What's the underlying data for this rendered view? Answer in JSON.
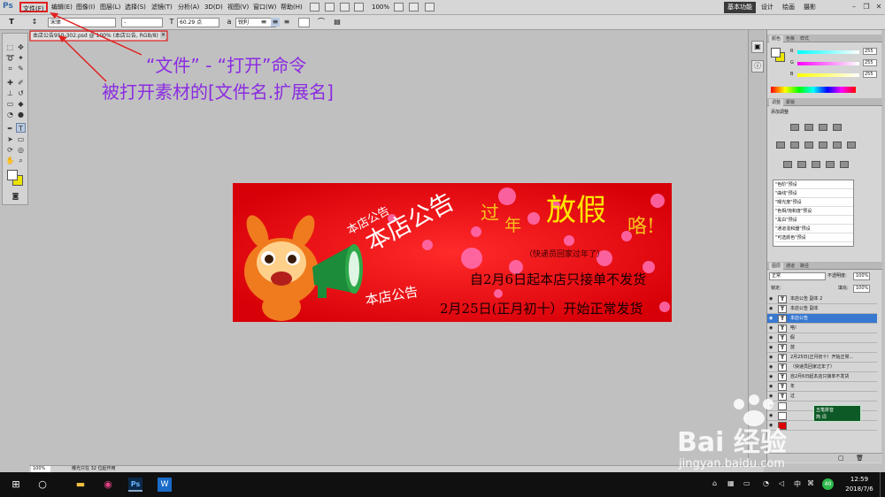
{
  "menubar": {
    "app_logo": "Ps",
    "items": [
      "文件(F)",
      "编辑(E)",
      "图像(I)",
      "图层(L)",
      "选择(S)",
      "滤镜(T)",
      "分析(A)",
      "3D(D)",
      "视图(V)",
      "窗口(W)",
      "帮助(H)"
    ],
    "zoom": "100%",
    "workspaces": [
      "基本功能",
      "设计",
      "绘画",
      "摄影"
    ],
    "window_controls": [
      "minimize-icon",
      "restore-icon",
      "close-icon"
    ]
  },
  "options": {
    "tool_glyph": "T",
    "font_family": "宋体",
    "font_style": "-",
    "font_size": "60.29 点",
    "aa_mode": "锐利",
    "align_icons": [
      "align-left-icon",
      "align-center-icon",
      "align-right-icon"
    ]
  },
  "document": {
    "tab_title": "本店公告950-302.psd @ 100% (本店公告, RGB/8)",
    "image": {
      "notice_title_big": "本店公告",
      "notice_title_small_top": "本店公告",
      "notice_title_small_bottom": "本店公告",
      "headline_guo": "过",
      "headline_nian": "年",
      "headline_fangjia": "放假",
      "headline_lo": "咯!",
      "courier_note": "（快递员回家过年了）",
      "line1": "自2月6日起本店只接单不发货",
      "line2": "2月25日(正月初十）开始正常发货"
    }
  },
  "annotations": {
    "line1": "“文件” - “打开”命令",
    "line2": "被打开素材的[文件名.扩展名]"
  },
  "status": {
    "zoom": "100%",
    "text": "曝光只在 32 位起作用"
  },
  "color_panel": {
    "tabs": [
      "颜色",
      "色板",
      "样式"
    ],
    "rows": [
      {
        "label": "R",
        "value": "255",
        "color": "#e03030"
      },
      {
        "label": "G",
        "value": "255",
        "color": "#30b030"
      },
      {
        "label": "B",
        "value": "255",
        "color": "#3050e0"
      }
    ]
  },
  "adjust_panel": {
    "tabs": [
      "调整",
      "蒙版"
    ],
    "title": "添加调整",
    "presets": [
      "\"色阶\"预设",
      "\"曲线\"预设",
      "\"曝光度\"预设",
      "\"色相/饱和度\"预设",
      "\"黑白\"预设",
      "\"通道混和器\"预设",
      "\"可选颜色\"预设"
    ]
  },
  "layers_panel": {
    "tabs": [
      "图层",
      "通道",
      "路径"
    ],
    "blend_mode": "正常",
    "opacity_label": "不透明度:",
    "opacity": "100%",
    "lock_label": "锁定:",
    "fill_label": "填充:",
    "fill": "100%",
    "layers": [
      {
        "name": "本店公告 副本 2",
        "selected": false
      },
      {
        "name": "本店公告 副本",
        "selected": false
      },
      {
        "name": "本店公告",
        "selected": true
      },
      {
        "name": "咯!",
        "selected": false
      },
      {
        "name": "假",
        "selected": false
      },
      {
        "name": "放",
        "selected": false
      },
      {
        "name": "2月25日(正月初十）开始正常...",
        "selected": false
      },
      {
        "name": "（快递员回家过年了）",
        "selected": false
      },
      {
        "name": "自2月6日起本店只接单不发货",
        "selected": false
      },
      {
        "name": "年",
        "selected": false
      },
      {
        "name": "过",
        "selected": false
      }
    ],
    "ime_line1": "五笔拼音",
    "ime_line2": "简 词"
  },
  "watermark": {
    "logo": "Bai 经验",
    "url": "jingyan.baidu.com"
  },
  "taskbar": {
    "time": "12:59",
    "date": "2018/7/6",
    "tray_badge": "40"
  }
}
